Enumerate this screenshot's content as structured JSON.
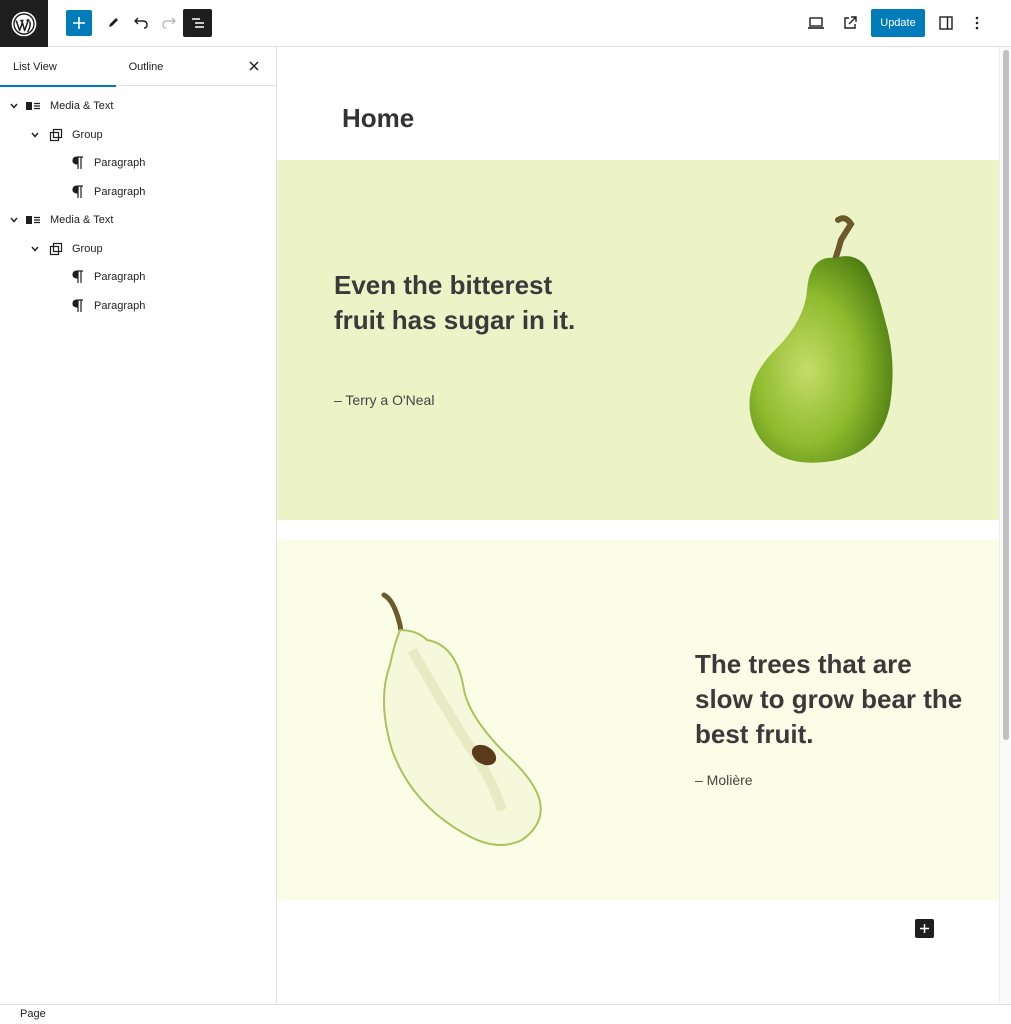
{
  "toolbar": {
    "logo_icon": "wordpress-logo",
    "inserter_icon": "plus-icon",
    "tools_icon": "pencil-icon",
    "undo_icon": "undo-icon",
    "redo_icon": "redo-icon",
    "list_view_icon": "list-view-icon",
    "preview_icon": "laptop-icon",
    "view_post_icon": "external-link-icon",
    "update_label": "Update",
    "settings_icon": "sidebar-icon",
    "options_icon": "more-vertical-icon",
    "accent_color": "#007cba"
  },
  "sidebar": {
    "tabs": [
      {
        "label": "List View",
        "active": true
      },
      {
        "label": "Outline",
        "active": false
      }
    ],
    "close_icon": "close-icon",
    "tree": [
      {
        "label": "Media & Text",
        "icon": "media-text-icon",
        "level": 1,
        "expanded": true
      },
      {
        "label": "Group",
        "icon": "group-icon",
        "level": 2,
        "expanded": true
      },
      {
        "label": "Paragraph",
        "icon": "paragraph-icon",
        "level": 3
      },
      {
        "label": "Paragraph",
        "icon": "paragraph-icon",
        "level": 3
      },
      {
        "label": "Media & Text",
        "icon": "media-text-icon",
        "level": 1,
        "expanded": true
      },
      {
        "label": "Group",
        "icon": "group-icon",
        "level": 2,
        "expanded": true
      },
      {
        "label": "Paragraph",
        "icon": "paragraph-icon",
        "level": 3
      },
      {
        "label": "Paragraph",
        "icon": "paragraph-icon",
        "level": 3
      }
    ]
  },
  "canvas": {
    "page_title": "Home",
    "blocks": [
      {
        "quote": "Even the bitterest fruit has sugar in it.",
        "cite": "– Terry a O'Neal",
        "image": "whole-pear-illustration",
        "background": "#ecf3c7"
      },
      {
        "quote": "The trees that are slow to grow bear the best fruit.",
        "cite": "– Molière",
        "image": "halved-pear-illustration",
        "background": "#fbfde7"
      }
    ],
    "add_block_icon": "plus-icon"
  },
  "footer": {
    "breadcrumb": "Page"
  }
}
